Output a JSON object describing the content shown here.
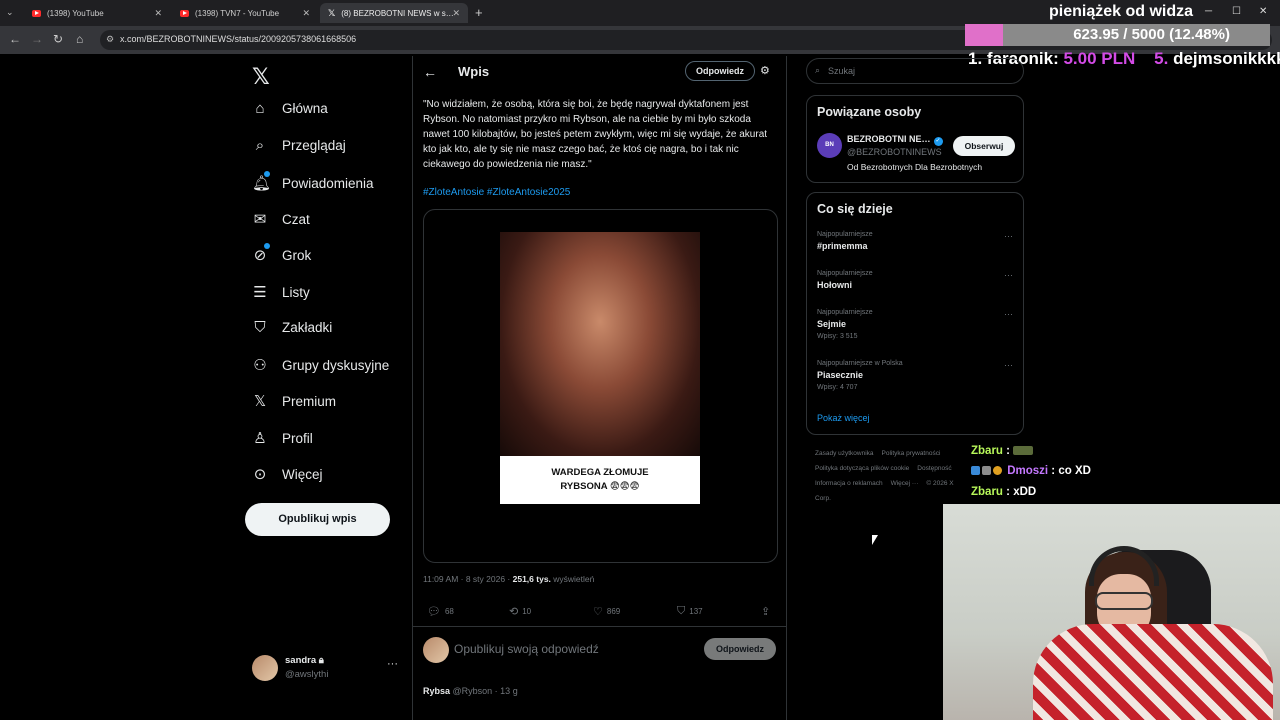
{
  "browser": {
    "tabs": [
      {
        "label": "(1398) YouTube",
        "active": false
      },
      {
        "label": "(1398) TVN7 - YouTube",
        "active": false
      },
      {
        "label": "(8) BEZROBOTNI NEWS w s…",
        "active": true
      }
    ],
    "url": "x.com/BEZROBOTNINEWS/status/2009205738061668506",
    "window_controls": {
      "minimize": "─",
      "maximize": "☐",
      "close": "✕"
    }
  },
  "stream_overlay": {
    "goal_title": "pieniążek od widza",
    "goal_progress_text": "623.95 / 5000 (12.48%)",
    "goal_progress_fraction": 0.1248,
    "top_donors": [
      {
        "rank": "1.",
        "name": "faraonik",
        "amount": "5.00 PLN"
      },
      {
        "rank": "5.",
        "name": "dejmsonikkkk",
        "amount": ""
      }
    ],
    "chat": [
      {
        "user": "Zbaru",
        "message": ""
      },
      {
        "user": "Dmoszi",
        "message": "co XD"
      },
      {
        "user": "Zbaru",
        "message": "xDD"
      }
    ],
    "colors": {
      "accent": "#e070c9",
      "chat_user": "#b7f75a",
      "chat_user2": "#c478ff"
    }
  },
  "sidebar": {
    "items": [
      {
        "label": "Główna",
        "icon": "home-icon"
      },
      {
        "label": "Przeglądaj",
        "icon": "search-icon"
      },
      {
        "label": "Powiadomienia",
        "icon": "bell-icon"
      },
      {
        "label": "Czat",
        "icon": "mail-icon"
      },
      {
        "label": "Grok",
        "icon": "grok-icon"
      },
      {
        "label": "Listy",
        "icon": "list-icon"
      },
      {
        "label": "Zakładki",
        "icon": "bookmark-icon"
      },
      {
        "label": "Grupy dyskusyjne",
        "icon": "people-icon"
      },
      {
        "label": "Premium",
        "icon": "x-logo-icon"
      },
      {
        "label": "Profil",
        "icon": "person-icon"
      },
      {
        "label": "Więcej",
        "icon": "more-circle-icon"
      }
    ],
    "post_button": "Opublikuj wpis",
    "user": {
      "name": "sandra",
      "handle": "@awslythi"
    }
  },
  "post": {
    "header_title": "Wpis",
    "header_reply_button": "Odpowiedz",
    "text": "\"No widziałem, że osobą, która się boi, że będę nagrywał dyktafonem jest Rybson. No natomiast przykro mi Rybson, ale na ciebie by mi było szkoda nawet 100 kilobajtów, bo jesteś petem zwykłym, więc mi się wydaje, że akurat kto jak kto, ale ty się nie masz czego bać, że ktoś cię nagra, bo i tak nic ciekawego do powiedzenia nie masz.\"",
    "hashtags": "#ZloteAntosie #ZloteAntosie2025",
    "media_caption_line1": "WARDEGA ZŁOMUJE",
    "media_caption_line2": "RYBSONA 😨😨😨",
    "time": "11:09 AM · 8 sty 2026 · ",
    "views_count": "251,6 tys.",
    "views_label": " wyświetleń",
    "stats": {
      "replies": "68",
      "reposts": "10",
      "likes": "869",
      "bookmarks": "137"
    },
    "reply_placeholder": "Opublikuj swoją odpowiedź",
    "reply_button": "Odpowiedz",
    "next_reply_author": "Rybsa",
    "next_reply_handle": "@Rybson · 13 g"
  },
  "right": {
    "search_placeholder": "Szukaj",
    "related_title": "Powiązane osoby",
    "related": {
      "name": "BEZROBOTNI NE…",
      "handle": "@BEZROBOTNINEWS",
      "bio": "Od Bezrobotnych Dla Bezrobotnych",
      "follow": "Obserwuj"
    },
    "trends_title": "Co się dzieje",
    "trends": [
      {
        "context": "Najpopularniejsze",
        "name": "#primemma",
        "count": ""
      },
      {
        "context": "Najpopularniejsze",
        "name": "Hołowni",
        "count": ""
      },
      {
        "context": "Najpopularniejsze",
        "name": "Sejmie",
        "count": "Wpisy: 3 515"
      },
      {
        "context": "Najpopularniejsze w Polska",
        "name": "Piasecznie",
        "count": "Wpisy: 4 707"
      }
    ],
    "show_more": "Pokaż więcej",
    "footer": [
      "Zasady użytkownika",
      "Polityka prywatności",
      "Polityka dotycząca plików cookie",
      "Dostępność",
      "Informacja o reklamach",
      "Więcej ···",
      "© 2026 X Corp."
    ]
  }
}
